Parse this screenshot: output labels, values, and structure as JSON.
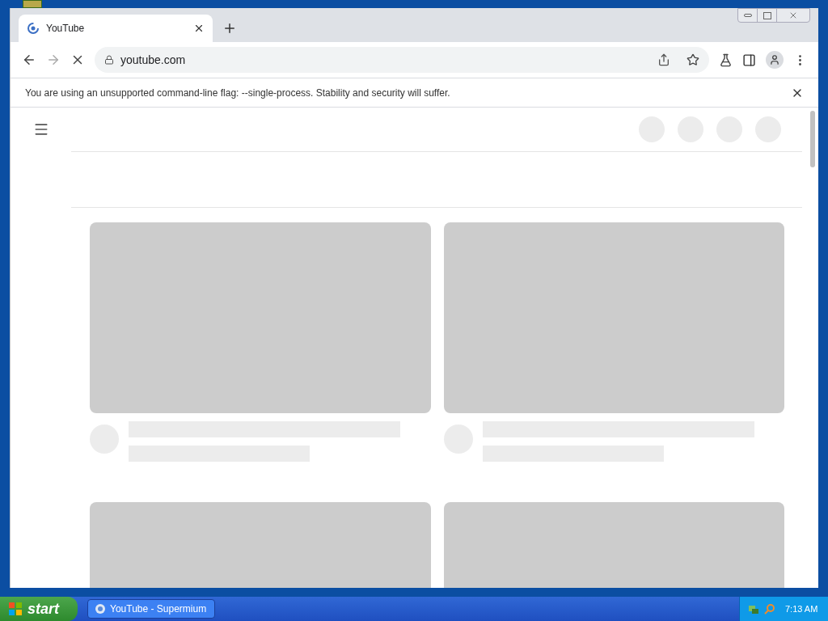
{
  "browser": {
    "tabs": [
      {
        "title": "YouTube",
        "selected": true
      }
    ],
    "address": "youtube.com",
    "infobar": "You are using an unsupported command-line flag: --single-process. Stability and security will suffer."
  },
  "taskbar": {
    "start": "start",
    "items": [
      {
        "label": "YouTube - Supermium",
        "selected": false
      }
    ],
    "clock": "7:13 AM"
  }
}
